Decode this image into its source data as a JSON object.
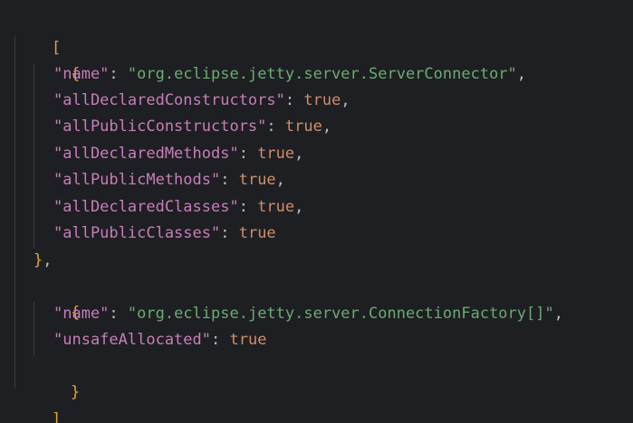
{
  "editor": {
    "colors": {
      "background": "#1e1f22",
      "bracket": "#d8a93a",
      "key": "#c77dbb",
      "string": "#6aab73",
      "keyword": "#cf8e6d",
      "punctuation": "#bcbec4"
    },
    "tokens": {
      "open_array": "[",
      "close_array": "]",
      "open_object": "{",
      "close_object_comma": "},",
      "close_object": "}",
      "colon": ": ",
      "comma": ","
    },
    "objects": [
      {
        "entries": [
          {
            "key": "\"name\"",
            "value": "\"org.eclipse.jetty.server.ServerConnector\"",
            "type": "string",
            "comma": ","
          },
          {
            "key": "\"allDeclaredConstructors\"",
            "value": "true",
            "type": "keyword",
            "comma": ","
          },
          {
            "key": "\"allPublicConstructors\"",
            "value": "true",
            "type": "keyword",
            "comma": ","
          },
          {
            "key": "\"allDeclaredMethods\"",
            "value": "true",
            "type": "keyword",
            "comma": ","
          },
          {
            "key": "\"allPublicMethods\"",
            "value": "true",
            "type": "keyword",
            "comma": ","
          },
          {
            "key": "\"allDeclaredClasses\"",
            "value": "true",
            "type": "keyword",
            "comma": ","
          },
          {
            "key": "\"allPublicClasses\"",
            "value": "true",
            "type": "keyword",
            "comma": ""
          }
        ]
      },
      {
        "entries": [
          {
            "key": "\"name\"",
            "value": "\"org.eclipse.jetty.server.ConnectionFactory[]\"",
            "type": "string",
            "comma": ","
          },
          {
            "key": "\"unsafeAllocated\"",
            "value": "true",
            "type": "keyword",
            "comma": ""
          }
        ]
      }
    ]
  }
}
